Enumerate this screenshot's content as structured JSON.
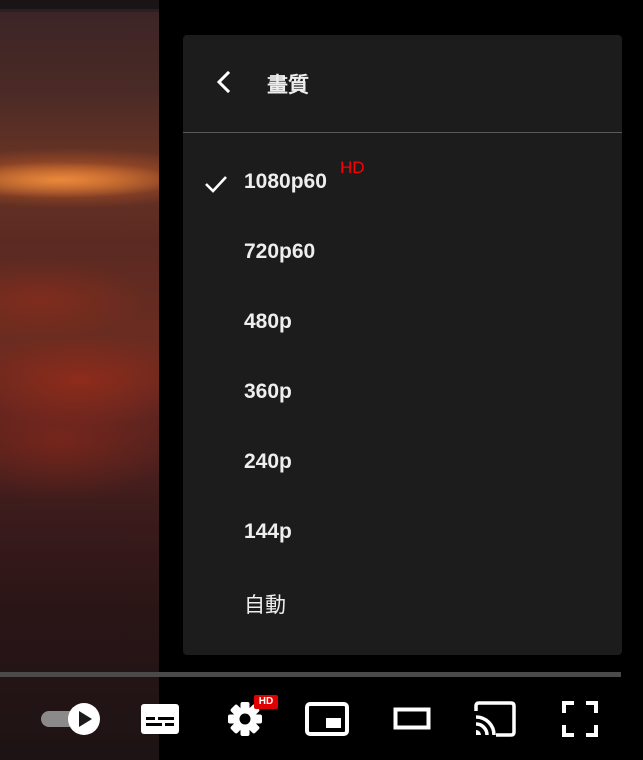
{
  "menu": {
    "title": "畫質",
    "back_icon": "chevron-left-icon",
    "options": [
      {
        "label": "1080p60",
        "badge": "HD",
        "selected": true
      },
      {
        "label": "720p60",
        "selected": false
      },
      {
        "label": "480p",
        "selected": false
      },
      {
        "label": "360p",
        "selected": false
      },
      {
        "label": "240p",
        "selected": false
      },
      {
        "label": "144p",
        "selected": false
      },
      {
        "label": "自動",
        "selected": false
      }
    ]
  },
  "controls": {
    "autoplay_icon": "autoplay-toggle-icon",
    "subtitles_icon": "subtitles-icon",
    "settings_icon": "gear-icon",
    "settings_badge": "HD",
    "miniplayer_icon": "miniplayer-icon",
    "theater_icon": "theater-mode-icon",
    "cast_icon": "cast-icon",
    "fullscreen_icon": "fullscreen-icon"
  },
  "colors": {
    "accent": "#ff0000",
    "menu_bg": "#1c1c1c",
    "text": "#eeeeee"
  }
}
